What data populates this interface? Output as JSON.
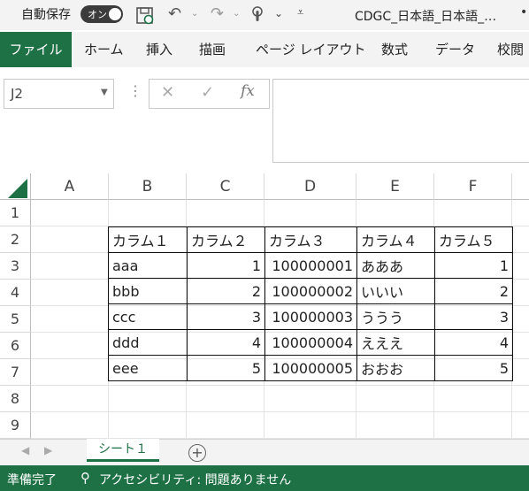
{
  "titlebar": {
    "autosave_label": "自動保存",
    "toggle_text": "オン",
    "document_title": "CDGC_日本語_日本語_…",
    "icons": [
      "save-icon",
      "undo-icon",
      "redo-icon",
      "touch-mode-icon",
      "customize-icon"
    ]
  },
  "ribbon": {
    "tabs": [
      "ファイル",
      "ホーム",
      "挿入",
      "描画",
      "ページ レイアウト",
      "数式",
      "データ",
      "校閲"
    ]
  },
  "formula_bar": {
    "name_box": "J2",
    "fx_label": "fx",
    "value": ""
  },
  "grid": {
    "columns": [
      "A",
      "B",
      "C",
      "D",
      "E",
      "F"
    ],
    "rows": [
      "1",
      "2",
      "3",
      "4",
      "5",
      "6",
      "7",
      "8",
      "9"
    ],
    "table": {
      "headers": [
        "カラム１",
        "カラム２",
        "カラム３",
        "カラム４",
        "カラム５"
      ],
      "rows": [
        [
          "aaa",
          "1",
          "100000001",
          "あああ",
          "1"
        ],
        [
          "bbb",
          "2",
          "100000002",
          "いいい",
          "2"
        ],
        [
          "ccc",
          "3",
          "100000003",
          "ううう",
          "3"
        ],
        [
          "ddd",
          "4",
          "100000004",
          "えええ",
          "4"
        ],
        [
          "eee",
          "5",
          "100000005",
          "おおお",
          "5"
        ]
      ]
    }
  },
  "sheets": {
    "active": "シート１",
    "add_label": "+"
  },
  "status": {
    "ready": "準備完了",
    "accessibility": "アクセシビリティ: 問題ありません"
  },
  "colors": {
    "accent": "#1e7145"
  }
}
